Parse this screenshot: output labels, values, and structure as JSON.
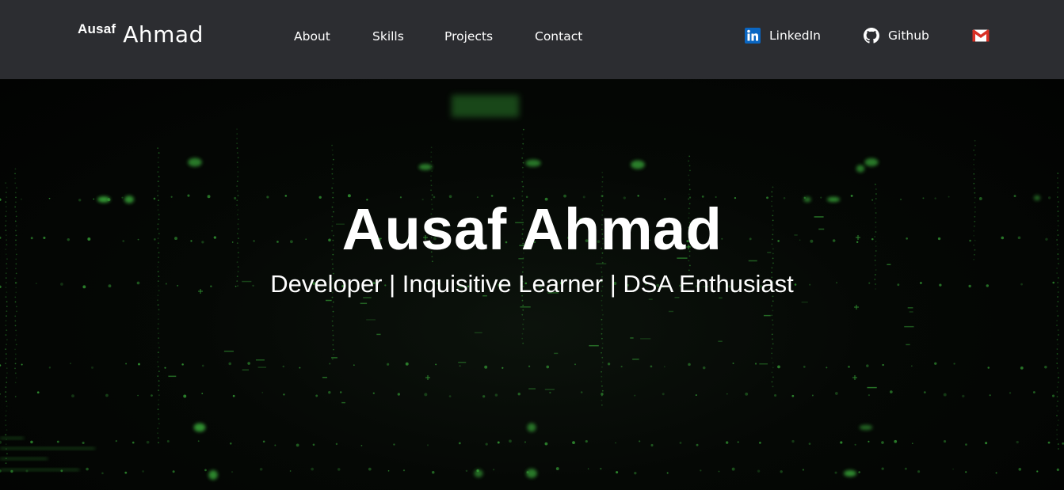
{
  "navbar": {
    "brand": {
      "first": "Ausaf",
      "last": "Ahmad"
    },
    "links": [
      {
        "label": "About"
      },
      {
        "label": "Skills"
      },
      {
        "label": "Projects"
      },
      {
        "label": "Contact"
      }
    ],
    "social": [
      {
        "label": "LinkedIn",
        "icon": "linkedin-icon",
        "color": "#0a66c2"
      },
      {
        "label": "Github",
        "icon": "github-icon"
      },
      {
        "label": "",
        "icon": "gmail-icon",
        "color": "#d93025"
      }
    ]
  },
  "hero": {
    "title": "Ausaf Ahmad",
    "subtitle": "Developer | Inquisitive Learner | DSA Enthusiast",
    "accent": "#3fbf3f"
  }
}
